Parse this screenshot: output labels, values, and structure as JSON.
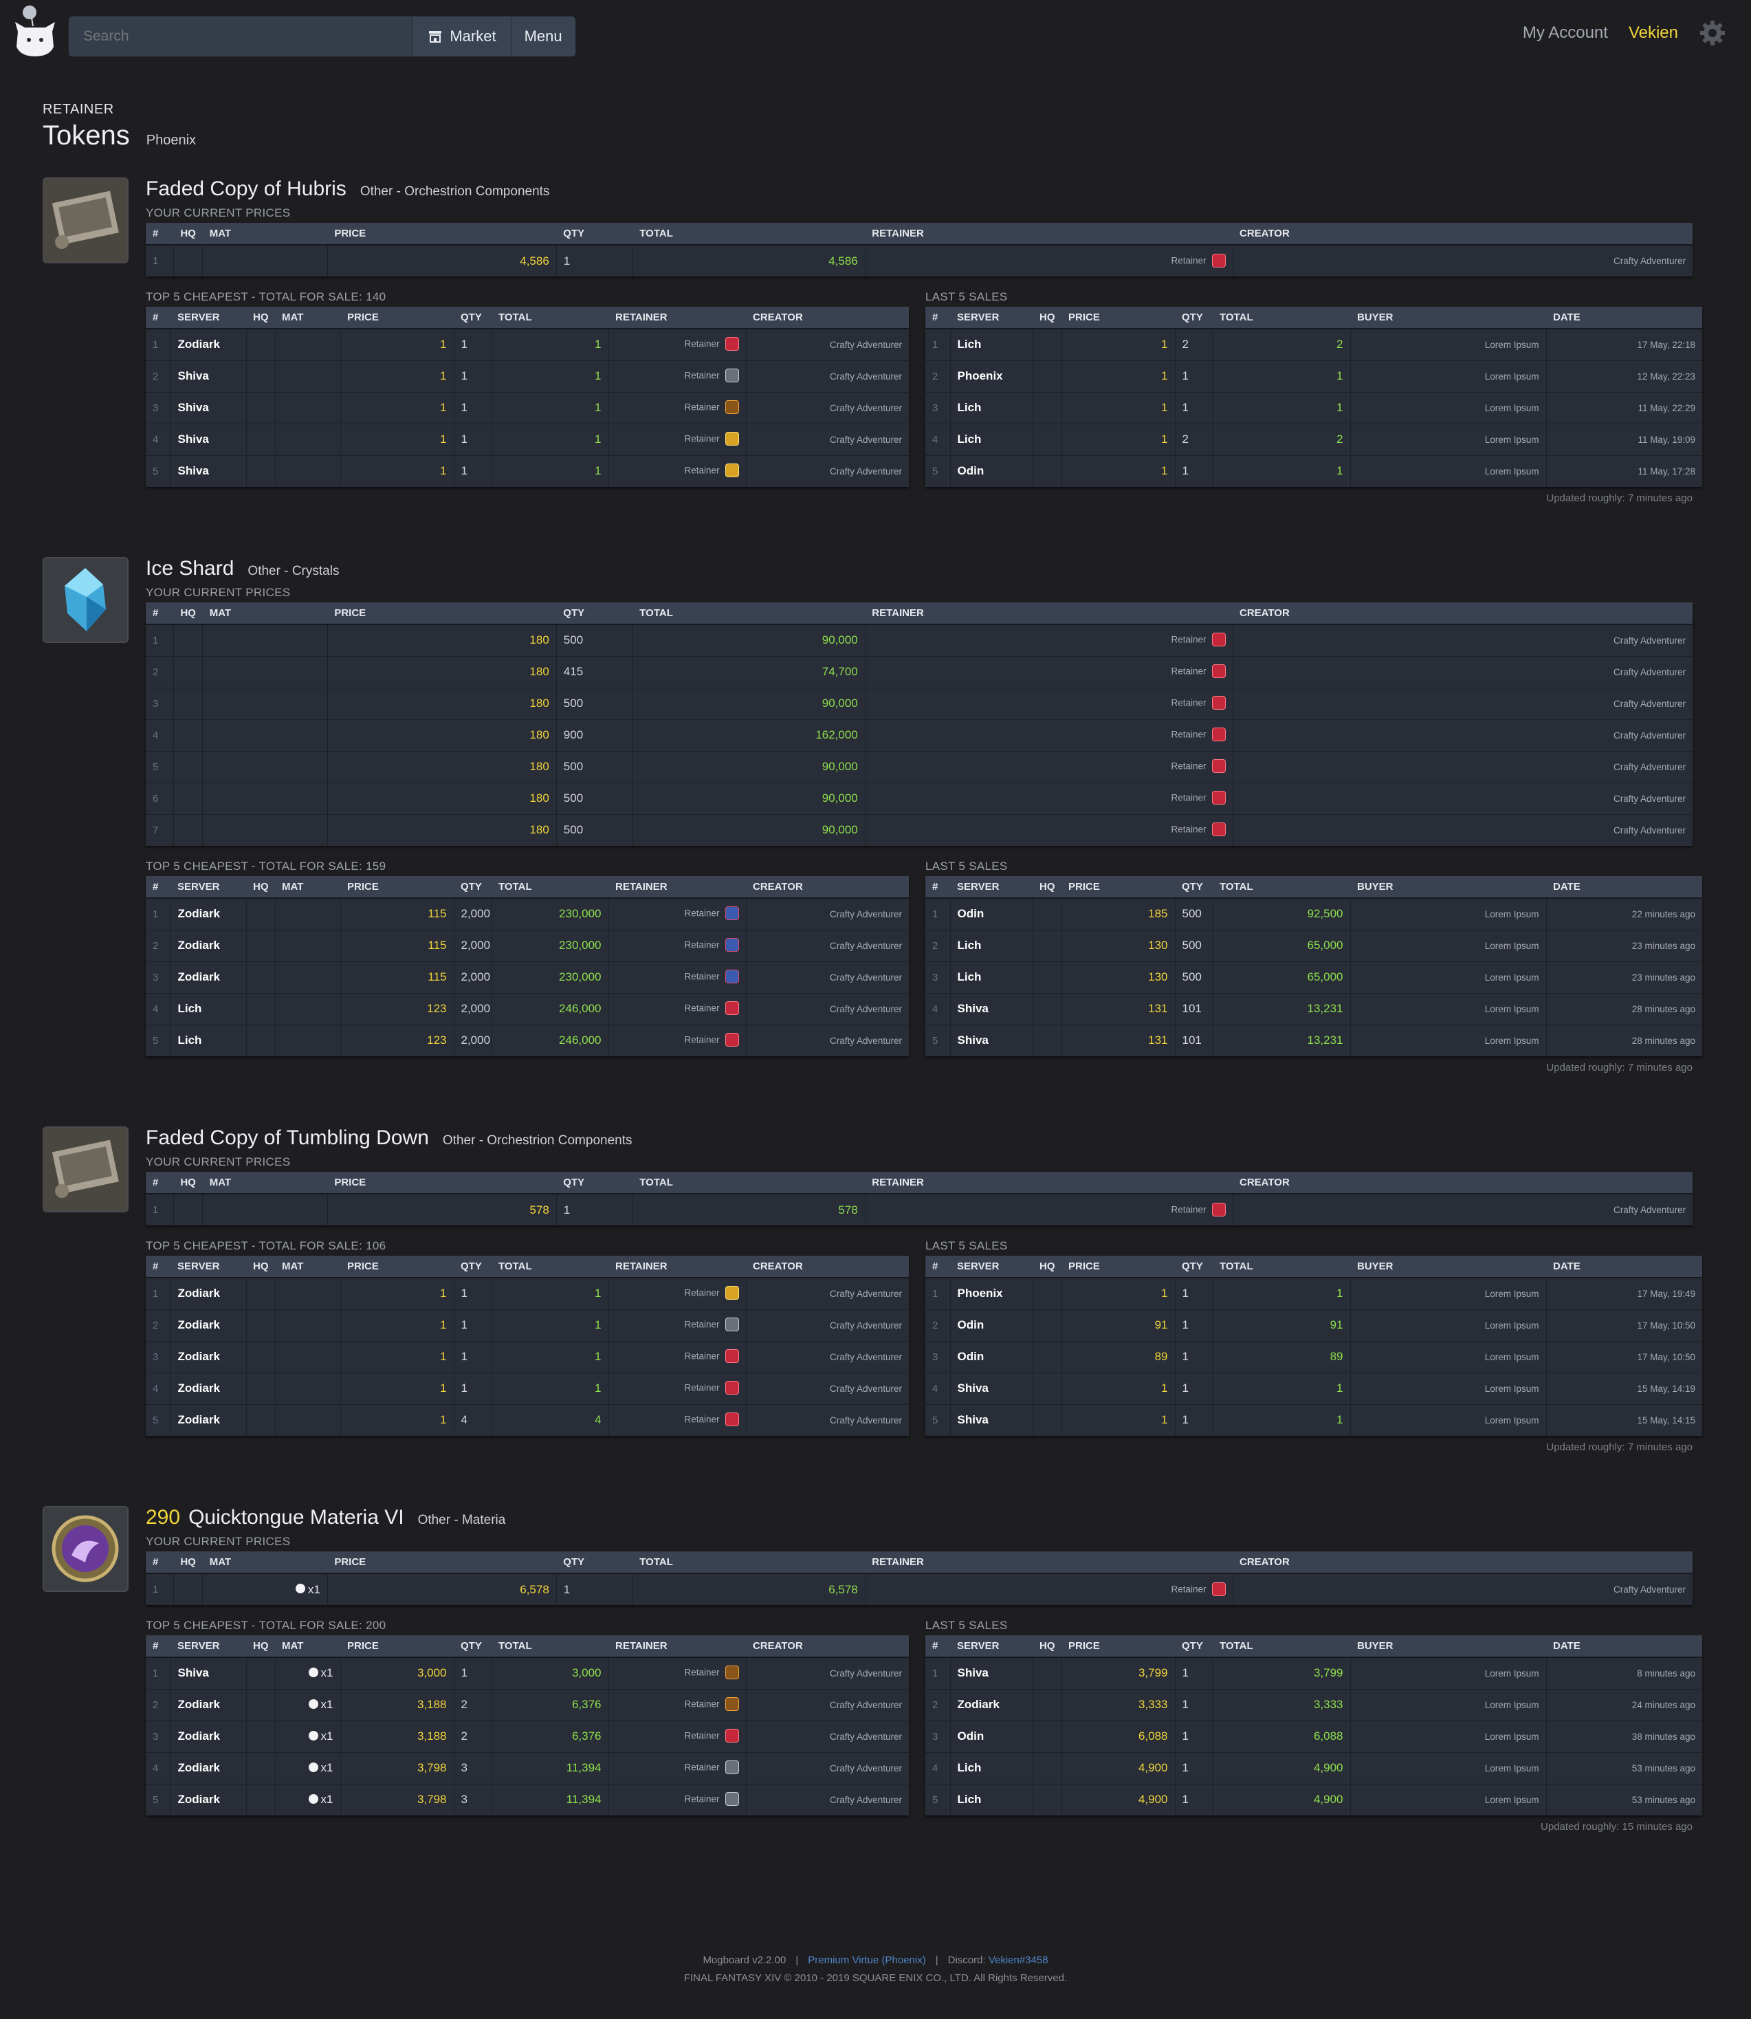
{
  "header": {
    "search_placeholder": "Search",
    "market_label": "Market",
    "menu_label": "Menu",
    "account_label": "My Account",
    "user_name": "Vekien"
  },
  "page": {
    "subtitle": "RETAINER",
    "title": "Tokens",
    "server": "Phoenix"
  },
  "labels": {
    "current_prices": "YOUR CURRENT PRICES",
    "last_sales": "LAST 5 SALES"
  },
  "columns": {
    "current": [
      "#",
      "HQ",
      "MAT",
      "PRICE",
      "QTY",
      "TOTAL",
      "RETAINER",
      "CREATOR"
    ],
    "cheapest": [
      "#",
      "SERVER",
      "HQ",
      "MAT",
      "PRICE",
      "QTY",
      "TOTAL",
      "RETAINER",
      "CREATOR"
    ],
    "sales": [
      "#",
      "SERVER",
      "HQ",
      "PRICE",
      "QTY",
      "TOTAL",
      "BUYER",
      "DATE"
    ]
  },
  "items": [
    {
      "name": "Faded Copy of Hubris",
      "level": "",
      "category": "Other - Orchestrion Components",
      "icon": "orchestrion-roll-icon",
      "current": [
        [
          "1",
          "",
          "",
          "4,586",
          "1",
          "4,586",
          "Retainer",
          "red",
          "Crafty Adventurer"
        ]
      ],
      "cheapest_label": "TOP 5 CHEAPEST - TOTAL FOR SALE: 140",
      "cheapest": [
        [
          "1",
          "Zodiark",
          "",
          "",
          "1",
          "1",
          "1",
          "Retainer",
          "red",
          "Crafty Adventurer"
        ],
        [
          "2",
          "Shiva",
          "",
          "",
          "1",
          "1",
          "1",
          "Retainer",
          "gray",
          "Crafty Adventurer"
        ],
        [
          "3",
          "Shiva",
          "",
          "",
          "1",
          "1",
          "1",
          "Retainer",
          "orange",
          "Crafty Adventurer"
        ],
        [
          "4",
          "Shiva",
          "",
          "",
          "1",
          "1",
          "1",
          "Retainer",
          "yellow",
          "Crafty Adventurer"
        ],
        [
          "5",
          "Shiva",
          "",
          "",
          "1",
          "1",
          "1",
          "Retainer",
          "yellow",
          "Crafty Adventurer"
        ]
      ],
      "sales": [
        [
          "1",
          "Lich",
          "",
          "1",
          "2",
          "2",
          "Lorem Ipsum",
          "17 May, 22:18"
        ],
        [
          "2",
          "Phoenix",
          "",
          "1",
          "1",
          "1",
          "Lorem Ipsum",
          "12 May, 22:23"
        ],
        [
          "3",
          "Lich",
          "",
          "1",
          "1",
          "1",
          "Lorem Ipsum",
          "11 May, 22:29"
        ],
        [
          "4",
          "Lich",
          "",
          "1",
          "2",
          "2",
          "Lorem Ipsum",
          "11 May, 19:09"
        ],
        [
          "5",
          "Odin",
          "",
          "1",
          "1",
          "1",
          "Lorem Ipsum",
          "11 May, 17:28"
        ]
      ],
      "updated": "Updated roughly: 7 minutes ago"
    },
    {
      "name": "Ice Shard",
      "level": "",
      "category": "Other - Crystals",
      "icon": "ice-shard-icon",
      "current": [
        [
          "1",
          "",
          "",
          "180",
          "500",
          "90,000",
          "Retainer",
          "red",
          "Crafty Adventurer"
        ],
        [
          "2",
          "",
          "",
          "180",
          "415",
          "74,700",
          "Retainer",
          "red",
          "Crafty Adventurer"
        ],
        [
          "3",
          "",
          "",
          "180",
          "500",
          "90,000",
          "Retainer",
          "red",
          "Crafty Adventurer"
        ],
        [
          "4",
          "",
          "",
          "180",
          "900",
          "162,000",
          "Retainer",
          "red",
          "Crafty Adventurer"
        ],
        [
          "5",
          "",
          "",
          "180",
          "500",
          "90,000",
          "Retainer",
          "red",
          "Crafty Adventurer"
        ],
        [
          "6",
          "",
          "",
          "180",
          "500",
          "90,000",
          "Retainer",
          "red",
          "Crafty Adventurer"
        ],
        [
          "7",
          "",
          "",
          "180",
          "500",
          "90,000",
          "Retainer",
          "red",
          "Crafty Adventurer"
        ]
      ],
      "cheapest_label": "TOP 5 CHEAPEST - TOTAL FOR SALE: 159",
      "cheapest": [
        [
          "1",
          "Zodiark",
          "",
          "",
          "115",
          "2,000",
          "230,000",
          "Retainer",
          "blue",
          "Crafty Adventurer"
        ],
        [
          "2",
          "Zodiark",
          "",
          "",
          "115",
          "2,000",
          "230,000",
          "Retainer",
          "blue",
          "Crafty Adventurer"
        ],
        [
          "3",
          "Zodiark",
          "",
          "",
          "115",
          "2,000",
          "230,000",
          "Retainer",
          "blue",
          "Crafty Adventurer"
        ],
        [
          "4",
          "Lich",
          "",
          "",
          "123",
          "2,000",
          "246,000",
          "Retainer",
          "red",
          "Crafty Adventurer"
        ],
        [
          "5",
          "Lich",
          "",
          "",
          "123",
          "2,000",
          "246,000",
          "Retainer",
          "red",
          "Crafty Adventurer"
        ]
      ],
      "sales": [
        [
          "1",
          "Odin",
          "",
          "185",
          "500",
          "92,500",
          "Lorem Ipsum",
          "22 minutes ago"
        ],
        [
          "2",
          "Lich",
          "",
          "130",
          "500",
          "65,000",
          "Lorem Ipsum",
          "23 minutes ago"
        ],
        [
          "3",
          "Lich",
          "",
          "130",
          "500",
          "65,000",
          "Lorem Ipsum",
          "23 minutes ago"
        ],
        [
          "4",
          "Shiva",
          "",
          "131",
          "101",
          "13,231",
          "Lorem Ipsum",
          "28 minutes ago"
        ],
        [
          "5",
          "Shiva",
          "",
          "131",
          "101",
          "13,231",
          "Lorem Ipsum",
          "28 minutes ago"
        ]
      ],
      "updated": "Updated roughly: 7 minutes ago"
    },
    {
      "name": "Faded Copy of Tumbling Down",
      "level": "",
      "category": "Other - Orchestrion Components",
      "icon": "orchestrion-roll-icon",
      "current": [
        [
          "1",
          "",
          "",
          "578",
          "1",
          "578",
          "Retainer",
          "red",
          "Crafty Adventurer"
        ]
      ],
      "cheapest_label": "TOP 5 CHEAPEST - TOTAL FOR SALE: 106",
      "cheapest": [
        [
          "1",
          "Zodiark",
          "",
          "",
          "1",
          "1",
          "1",
          "Retainer",
          "yellow",
          "Crafty Adventurer"
        ],
        [
          "2",
          "Zodiark",
          "",
          "",
          "1",
          "1",
          "1",
          "Retainer",
          "gray",
          "Crafty Adventurer"
        ],
        [
          "3",
          "Zodiark",
          "",
          "",
          "1",
          "1",
          "1",
          "Retainer",
          "red",
          "Crafty Adventurer"
        ],
        [
          "4",
          "Zodiark",
          "",
          "",
          "1",
          "1",
          "1",
          "Retainer",
          "red",
          "Crafty Adventurer"
        ],
        [
          "5",
          "Zodiark",
          "",
          "",
          "1",
          "4",
          "4",
          "Retainer",
          "red",
          "Crafty Adventurer"
        ]
      ],
      "sales": [
        [
          "1",
          "Phoenix",
          "",
          "1",
          "1",
          "1",
          "Lorem Ipsum",
          "17 May, 19:49"
        ],
        [
          "2",
          "Odin",
          "",
          "91",
          "1",
          "91",
          "Lorem Ipsum",
          "17 May, 10:50"
        ],
        [
          "3",
          "Odin",
          "",
          "89",
          "1",
          "89",
          "Lorem Ipsum",
          "17 May, 10:50"
        ],
        [
          "4",
          "Shiva",
          "",
          "1",
          "1",
          "1",
          "Lorem Ipsum",
          "15 May, 14:19"
        ],
        [
          "5",
          "Shiva",
          "",
          "1",
          "1",
          "1",
          "Lorem Ipsum",
          "15 May, 14:15"
        ]
      ],
      "updated": "Updated roughly: 7 minutes ago"
    },
    {
      "name": "Quicktongue Materia VI",
      "level": "290",
      "category": "Other - Materia",
      "icon": "materia-icon",
      "current": [
        [
          "1",
          "",
          "x1",
          "6,578",
          "1",
          "6,578",
          "Retainer",
          "red",
          "Crafty Adventurer"
        ]
      ],
      "cheapest_label": "TOP 5 CHEAPEST - TOTAL FOR SALE: 200",
      "cheapest": [
        [
          "1",
          "Shiva",
          "",
          "x1",
          "3,000",
          "1",
          "3,000",
          "Retainer",
          "orange",
          "Crafty Adventurer"
        ],
        [
          "2",
          "Zodiark",
          "",
          "x1",
          "3,188",
          "2",
          "6,376",
          "Retainer",
          "orange",
          "Crafty Adventurer"
        ],
        [
          "3",
          "Zodiark",
          "",
          "x1",
          "3,188",
          "2",
          "6,376",
          "Retainer",
          "red",
          "Crafty Adventurer"
        ],
        [
          "4",
          "Zodiark",
          "",
          "x1",
          "3,798",
          "3",
          "11,394",
          "Retainer",
          "gray",
          "Crafty Adventurer"
        ],
        [
          "5",
          "Zodiark",
          "",
          "x1",
          "3,798",
          "3",
          "11,394",
          "Retainer",
          "gray",
          "Crafty Adventurer"
        ]
      ],
      "sales": [
        [
          "1",
          "Shiva",
          "",
          "3,799",
          "1",
          "3,799",
          "Lorem Ipsum",
          "8 minutes ago"
        ],
        [
          "2",
          "Zodiark",
          "",
          "3,333",
          "1",
          "3,333",
          "Lorem Ipsum",
          "24 minutes ago"
        ],
        [
          "3",
          "Odin",
          "",
          "6,088",
          "1",
          "6,088",
          "Lorem Ipsum",
          "38 minutes ago"
        ],
        [
          "4",
          "Lich",
          "",
          "4,900",
          "1",
          "4,900",
          "Lorem Ipsum",
          "53 minutes ago"
        ],
        [
          "5",
          "Lich",
          "",
          "4,900",
          "1",
          "4,900",
          "Lorem Ipsum",
          "53 minutes ago"
        ]
      ],
      "updated": "Updated roughly: 15 minutes ago"
    }
  ],
  "footer": {
    "version": "Mogboard v2.2.00",
    "sep": "|",
    "patron_link": "Premium Virtue (Phoenix)",
    "discord_label": "Discord:",
    "discord_handle": "Vekien#3458",
    "copyright": "FINAL FANTASY XIV © 2010 - 2019 SQUARE ENIX CO., LTD. All Rights Reserved."
  }
}
